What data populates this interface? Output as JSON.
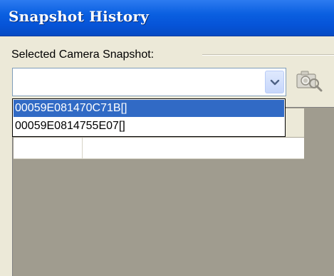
{
  "window": {
    "title": "Snapshot History"
  },
  "camera_select": {
    "label": "Selected Camera Snapshot:",
    "value": "",
    "options": [
      "00059E081470C71B[]",
      "00059E0814755E07[]"
    ],
    "highlighted_index": 0
  },
  "icons": {
    "dropdown_arrow": "chevron-down-icon",
    "snapshot": "camera-search-icon"
  },
  "colors": {
    "titlebar": "#0654d8",
    "selection": "#316ac5",
    "background": "#ece9d8"
  }
}
